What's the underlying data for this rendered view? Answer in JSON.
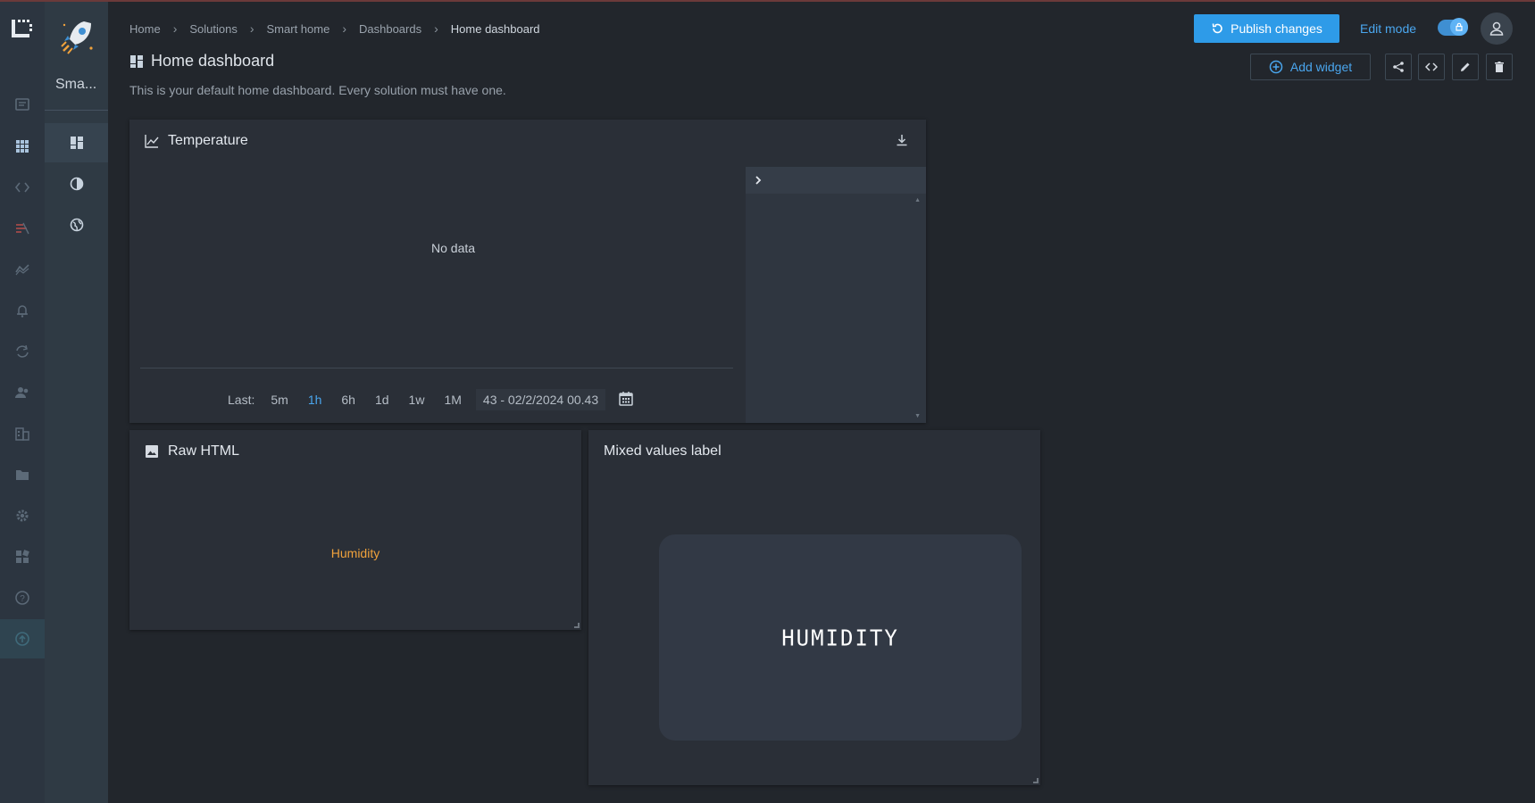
{
  "solution_panel": {
    "name": "Sma..."
  },
  "breadcrumb": [
    "Home",
    "Solutions",
    "Smart home",
    "Dashboards",
    "Home dashboard"
  ],
  "header": {
    "publish_label": "Publish changes",
    "edit_mode_label": "Edit mode",
    "edit_mode_on": true
  },
  "page": {
    "title": "Home dashboard",
    "description": "This is your default home dashboard. Every solution must have one.",
    "add_widget_label": "Add widget"
  },
  "widgets": {
    "temperature": {
      "title": "Temperature",
      "empty_text": "No data",
      "time_label": "Last:",
      "time_options": [
        "5m",
        "1h",
        "6h",
        "1d",
        "1w",
        "1M"
      ],
      "active_option": "1h",
      "range_text": "43 - 02/2/2024 00.43"
    },
    "raw_html": {
      "title": "Raw HTML",
      "content": "Humidity"
    },
    "mixed": {
      "title": "Mixed values label",
      "display": "HUMIDITY"
    }
  },
  "colors": {
    "accent": "#2e9be8",
    "link": "#4aa6ee",
    "humidity_text": "#f0a23c",
    "background": "#22262c"
  }
}
